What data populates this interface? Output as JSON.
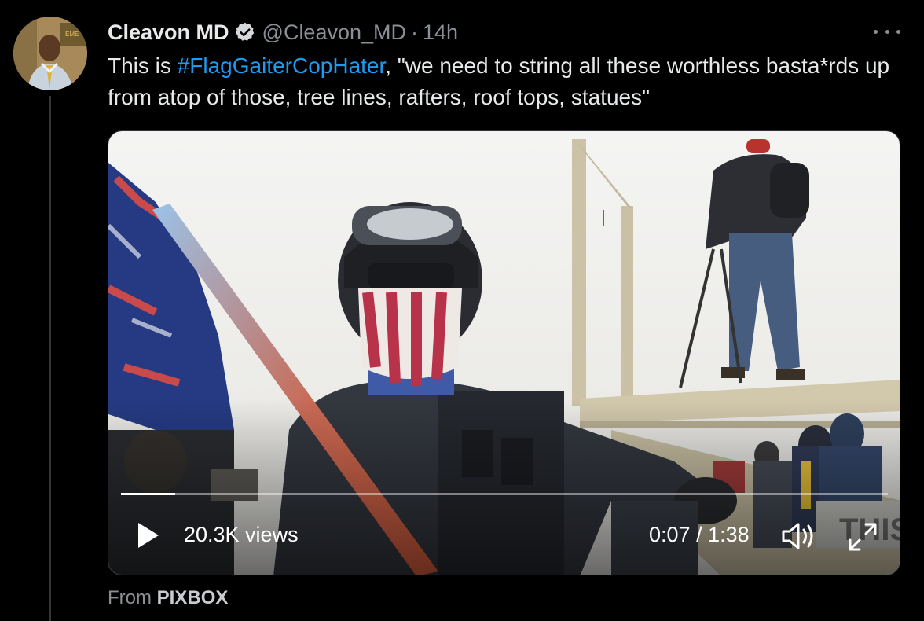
{
  "tweet": {
    "author": {
      "display_name": "Cleavon MD",
      "handle": "@Cleavon_MD",
      "verified_icon": "verified-badge-icon"
    },
    "separator": "·",
    "time": "14h",
    "text_prefix": "This is ",
    "hashtag": "#FlagGaiterCopHater",
    "text_suffix": ", \"we need to string all these worthless basta*rds up from atop of those, tree lines, rafters, roof tops, statues\"",
    "more_icon": "more-dots-icon"
  },
  "video": {
    "views": "20.3K views",
    "current_time": "0:07",
    "time_separator": " / ",
    "duration": "1:38",
    "progress": 0.071,
    "play_icon": "play-icon",
    "volume_icon": "volume-icon",
    "fullscreen_icon": "fullscreen-icon"
  },
  "source": {
    "prefix": "From ",
    "name": "PIXBOX"
  },
  "colors": {
    "background": "#000000",
    "primary_text": "#e7e9ea",
    "secondary_text": "#8b8f94",
    "hashtag": "#1d9bf0",
    "thread_line": "#333639"
  }
}
